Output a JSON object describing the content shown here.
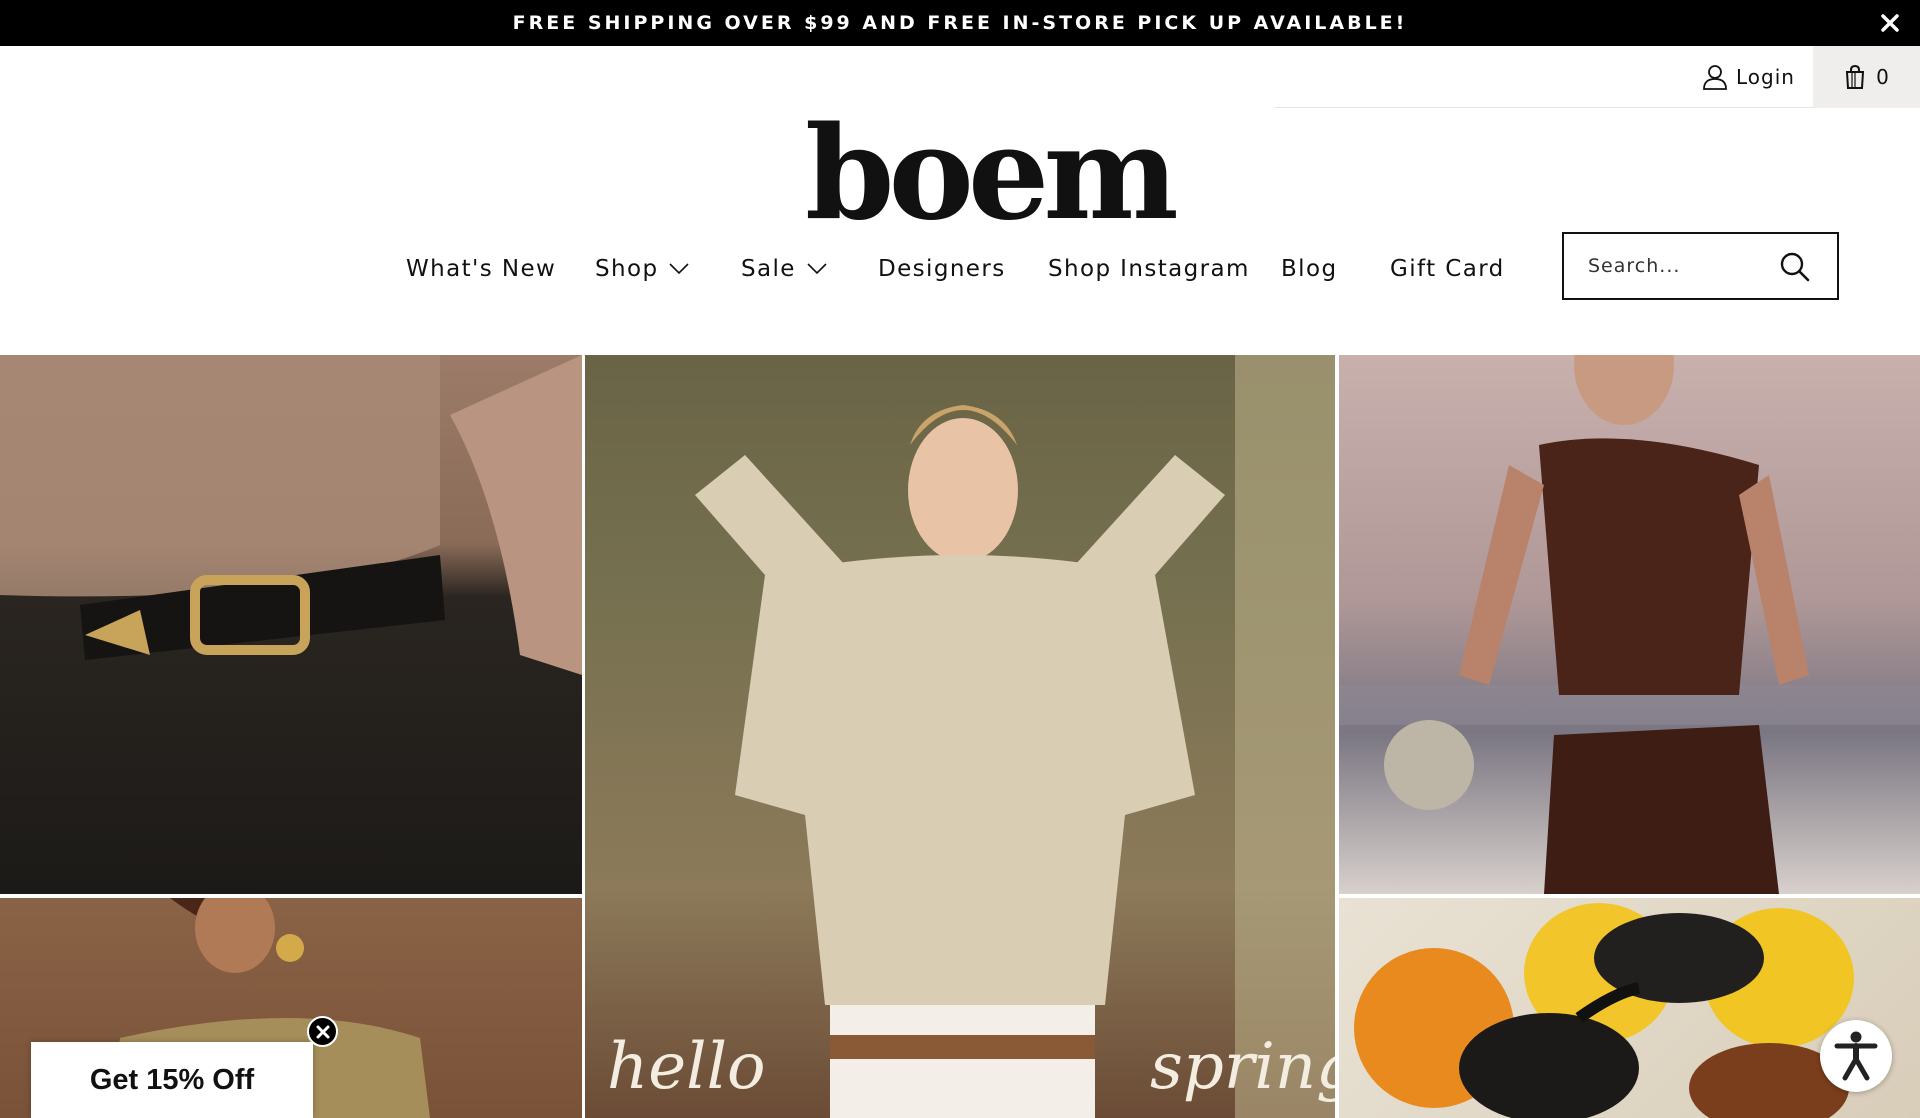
{
  "announcement": {
    "text": "FREE SHIPPING OVER $99 AND FREE IN-STORE PICK UP AVAILABLE!",
    "close_icon": "close-icon"
  },
  "account": {
    "login_label": "Login",
    "user_icon": "user-icon",
    "cart_icon": "shopping-bag-icon",
    "cart_count": "0"
  },
  "logo": {
    "text": "boem"
  },
  "nav": {
    "items": [
      {
        "label": "What's New",
        "has_dropdown": false
      },
      {
        "label": "Shop",
        "has_dropdown": true
      },
      {
        "label": "Sale",
        "has_dropdown": true
      },
      {
        "label": "Designers",
        "has_dropdown": false
      },
      {
        "label": "Shop Instagram",
        "has_dropdown": false
      },
      {
        "label": "Blog",
        "has_dropdown": false
      },
      {
        "label": "Gift Card",
        "has_dropdown": false
      }
    ]
  },
  "search": {
    "placeholder": "Search...",
    "icon": "search-icon"
  },
  "hero": {
    "hello_text": "hello",
    "spring_text": "spring"
  },
  "promo": {
    "label": "Get 15% Off",
    "close_icon": "close-icon"
  },
  "accessibility": {
    "icon": "accessibility-icon"
  },
  "colors": {
    "announcement_bg": "#000000",
    "cart_bg": "#f0eeec",
    "text": "#111111"
  }
}
